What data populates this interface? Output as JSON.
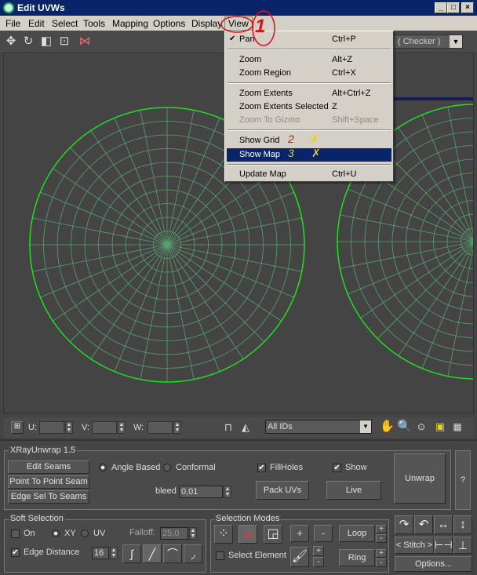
{
  "window": {
    "title": "Edit UVWs",
    "min": "_",
    "max": "□",
    "close": "×"
  },
  "menu": [
    "File",
    "Edit",
    "Select",
    "Tools",
    "Mapping",
    "Options",
    "Display",
    "View"
  ],
  "toolbar": {
    "checker": "( Checker )"
  },
  "viewmenu": {
    "items": [
      {
        "label": "Pan",
        "shortcut": "Ctrl+P",
        "checked": "✔"
      },
      {
        "label": "Zoom",
        "shortcut": "Alt+Z"
      },
      {
        "label": "Zoom Region",
        "shortcut": "Ctrl+X"
      },
      {
        "label": "Zoom Extents",
        "shortcut": "Alt+Ctrl+Z"
      },
      {
        "label": "Zoom Extents Selected",
        "shortcut": "Z"
      },
      {
        "label": "Zoom To Gizmo",
        "shortcut": "Shift+Space"
      },
      {
        "label": "Show Grid",
        "shortcut": ""
      },
      {
        "label": "Show Map",
        "shortcut": ""
      },
      {
        "label": "Update Map",
        "shortcut": "Ctrl+U"
      }
    ],
    "annotations": [
      "1",
      "2",
      "3"
    ]
  },
  "uvstrip": {
    "u_label": "U:",
    "v_label": "V:",
    "w_label": "W:",
    "ids": "All IDs"
  },
  "xray": {
    "title": "XRayUnwrap 1.5",
    "edit_seams": "Edit Seams",
    "p2p_seam": "Point To Point Seam",
    "edge_sel": "Edge Sel To Seams",
    "angle_based": "Angle Based",
    "conformal": "Conformal",
    "fillholes": "FillHoles",
    "show": "Show",
    "bleed_label": "bleed",
    "bleed_value": "0,01",
    "pack_uvs": "Pack UVs",
    "live": "Live",
    "unwrap": "Unwrap",
    "help": "?"
  },
  "soft": {
    "title": "Soft Selection",
    "on": "On",
    "xy": "XY",
    "uv": "UV",
    "falloff_label": "Falloff:",
    "falloff_value": "25,0",
    "edge_distance": "Edge Distance",
    "edge_value": "16"
  },
  "selmodes": {
    "title": "Selection Modes",
    "select_element": "Select Element",
    "plus": "+",
    "minus": "-",
    "loop": "Loop",
    "ring": "Ring"
  },
  "rightpanel": {
    "stitch": "Stitch",
    "options": "Options..."
  },
  "colors": {
    "wire": "#5aa070",
    "edge": "#22dd22",
    "highlight": "#0a246a",
    "annotation": "#dd1111"
  }
}
